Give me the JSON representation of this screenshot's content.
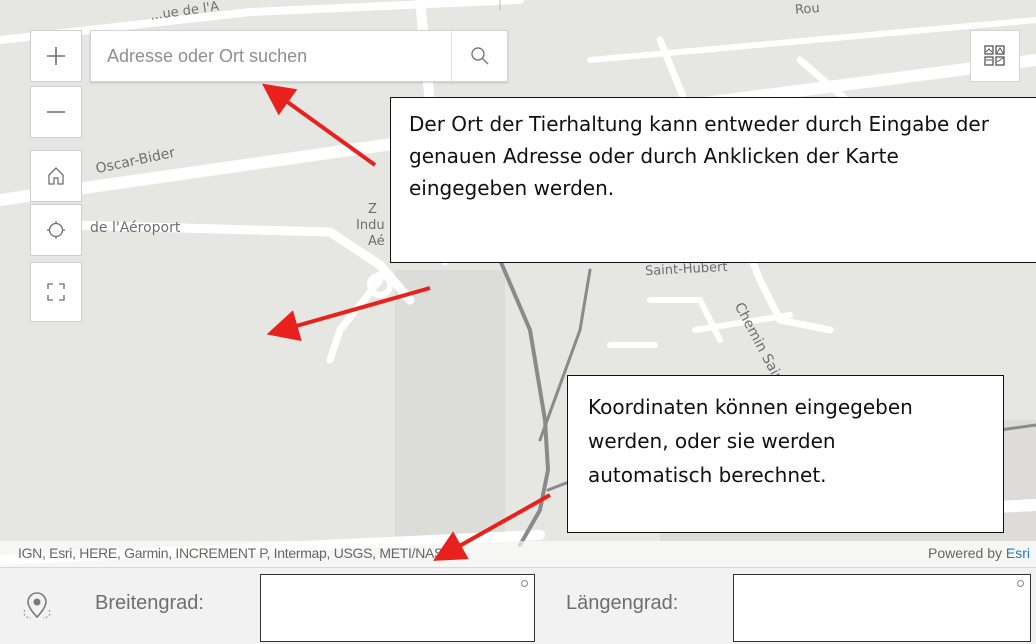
{
  "map": {
    "street_labels": [
      {
        "id": "street-label-top-left",
        "text": "...ue de l'A"
      },
      {
        "id": "street-label-top-right",
        "text": "Rou"
      },
      {
        "id": "street-label-oscar-bider",
        "text": "Oscar-Bider"
      },
      {
        "id": "street-label-aeroport",
        "text": "de l'Aéroport"
      },
      {
        "id": "street-label-zone-1",
        "text": "Z"
      },
      {
        "id": "street-label-zone-2",
        "text": "Indu"
      },
      {
        "id": "street-label-zone-3",
        "text": "Aé"
      },
      {
        "id": "street-label-saint-hubert",
        "text": "Saint-Hubert"
      },
      {
        "id": "street-label-chemin",
        "text": "Chemin Saint-H"
      }
    ]
  },
  "controls": {
    "zoom_in_icon": "plus-icon",
    "zoom_out_icon": "minus-icon",
    "home_icon": "home-icon",
    "locate_icon": "locate-icon",
    "fullscreen_icon": "fullscreen-icon",
    "basemap_icon": "basemap-gallery-icon"
  },
  "search": {
    "placeholder": "Adresse oder Ort suchen",
    "icon": "search-icon"
  },
  "callouts": {
    "location_hint_lines": [
      "Der Ort der Tierhaltung kann entweder durch Eingabe der",
      "genauen Adresse oder durch Anklicken der Karte",
      "eingegeben werden."
    ],
    "coordinates_hint_lines": [
      "Koordinaten können eingegeben",
      "werden, oder sie werden",
      "automatisch berechnet."
    ]
  },
  "attribution": {
    "text": "IGN, Esri, HERE, Garmin, INCREMENT P, Intermap, USGS, METI/NASA",
    "powered_by": "Powered by ",
    "esri": "Esri"
  },
  "coordinates": {
    "pin_icon": "location-pin-icon",
    "latitude_label": "Breitengrad:",
    "latitude_value": "",
    "longitude_label": "Längengrad:",
    "longitude_value": ""
  },
  "colors": {
    "map_background": "#e6e6e3",
    "road": "#ffffff",
    "major_road": "#8a8a8a",
    "annotation_arrow": "#e8211c",
    "esri_link": "#2878b8"
  }
}
